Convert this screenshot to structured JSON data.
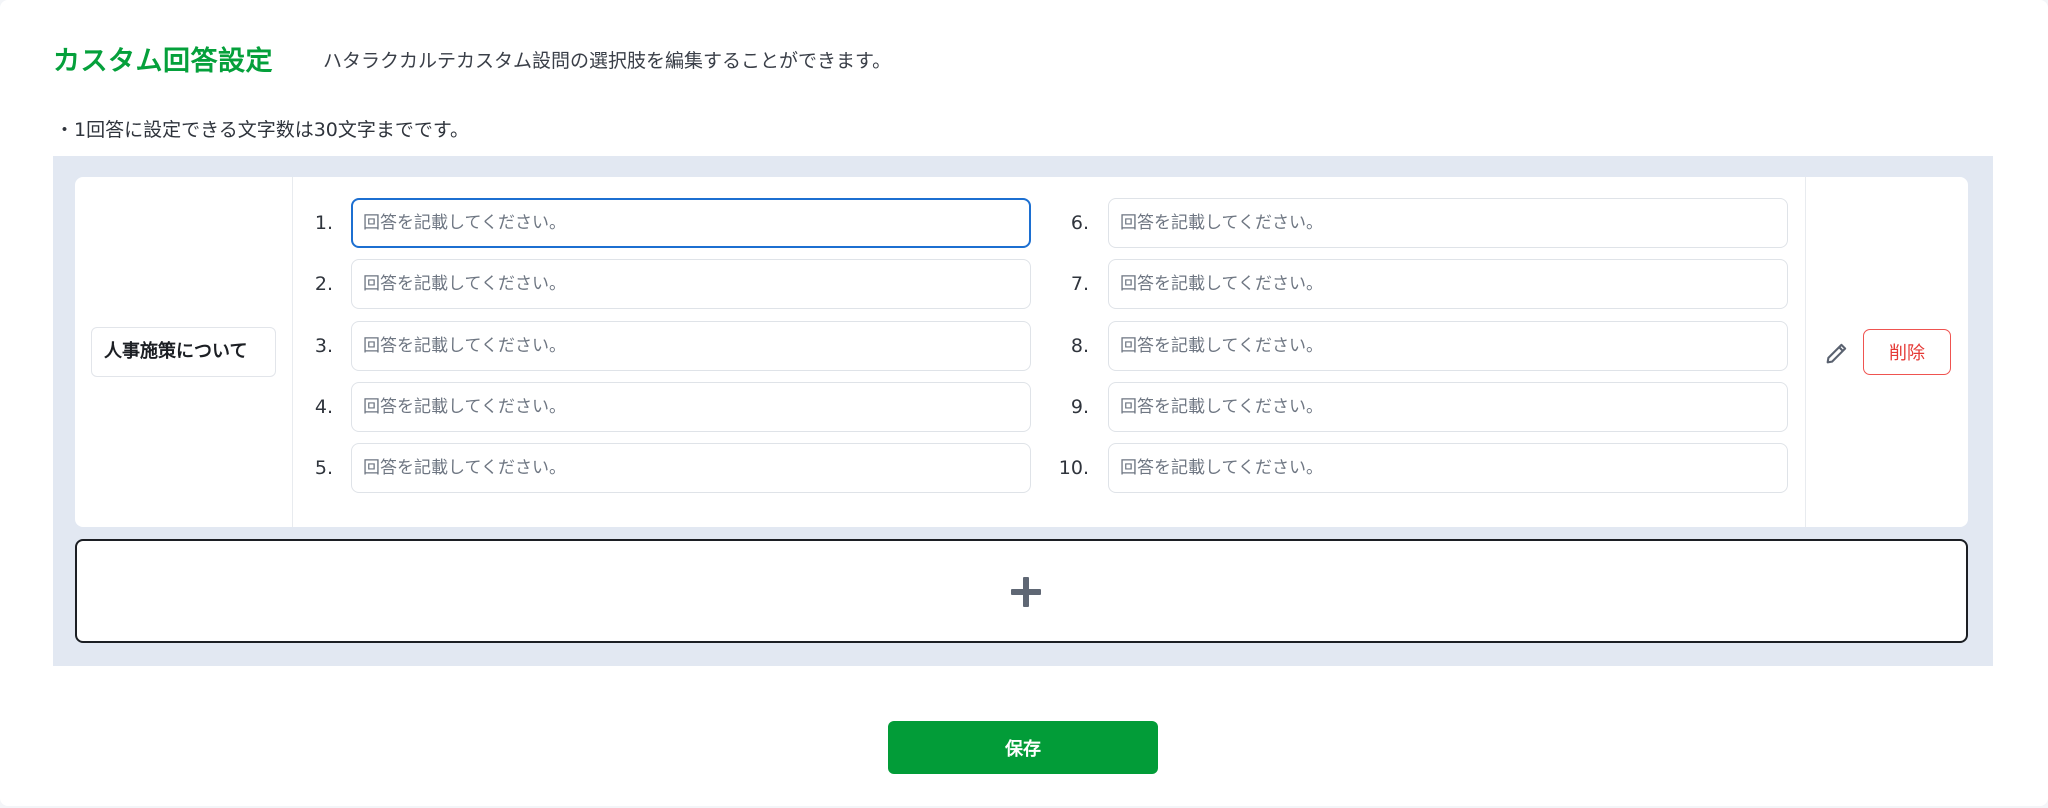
{
  "header": {
    "title": "カスタム回答設定",
    "description": "ハタラクカルテカスタム設問の選択肢を編集することができます。"
  },
  "note": "・1回答に設定できる文字数は30文字までです。",
  "question": {
    "label": "人事施策について",
    "answers": [
      {
        "num": "1.",
        "value": "",
        "placeholder": "回答を記載してください。"
      },
      {
        "num": "2.",
        "value": "",
        "placeholder": "回答を記載してください。"
      },
      {
        "num": "3.",
        "value": "",
        "placeholder": "回答を記載してください。"
      },
      {
        "num": "4.",
        "value": "",
        "placeholder": "回答を記載してください。"
      },
      {
        "num": "5.",
        "value": "",
        "placeholder": "回答を記載してください。"
      },
      {
        "num": "6.",
        "value": "",
        "placeholder": "回答を記載してください。"
      },
      {
        "num": "7.",
        "value": "",
        "placeholder": "回答を記載してください。"
      },
      {
        "num": "8.",
        "value": "",
        "placeholder": "回答を記載してください。"
      },
      {
        "num": "9.",
        "value": "",
        "placeholder": "回答を記載してください。"
      },
      {
        "num": "10.",
        "value": "",
        "placeholder": "回答を記載してください。"
      }
    ],
    "edit_icon": "pencil-icon",
    "delete_label": "削除"
  },
  "add_icon": "plus-icon",
  "save_label": "保存",
  "colors": {
    "accent_green": "#05a03b",
    "save_button": "#029c38",
    "delete_red": "#e53935",
    "focus_blue": "#1c6fd1",
    "panel_bg": "#e2e8f2"
  }
}
